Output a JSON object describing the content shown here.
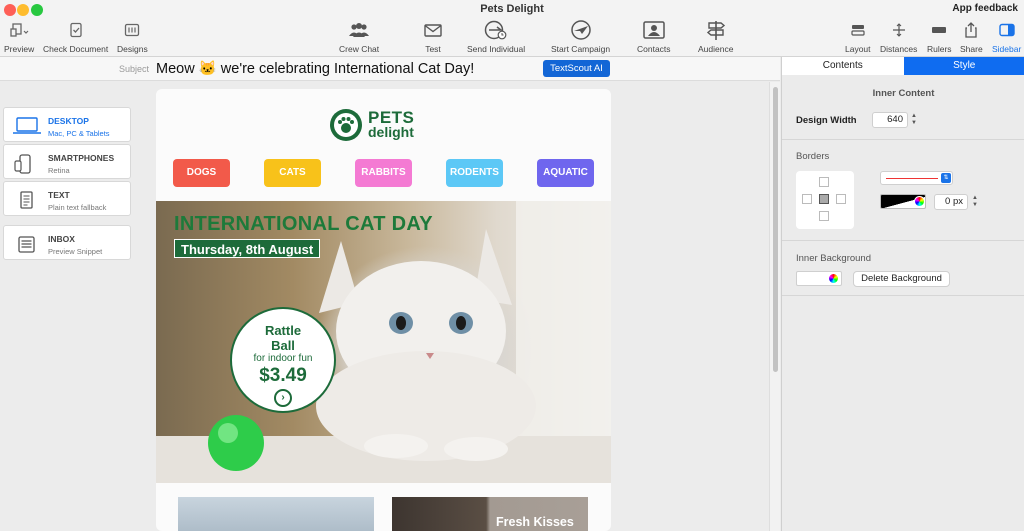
{
  "window": {
    "title": "Pets Delight",
    "feedback_label": "App feedback"
  },
  "toolbar": {
    "left": [
      {
        "label": "Preview",
        "icon": "preview-icon"
      },
      {
        "label": "Check Document",
        "icon": "check-document-icon"
      },
      {
        "label": "Designs",
        "icon": "designs-icon"
      }
    ],
    "center": [
      {
        "label": "Crew Chat",
        "icon": "crew-chat-icon"
      },
      {
        "label": "Test",
        "icon": "envelope-icon"
      },
      {
        "label": "Send Individual",
        "icon": "send-individual-icon"
      },
      {
        "label": "Start Campaign",
        "icon": "start-campaign-icon"
      },
      {
        "label": "Contacts",
        "icon": "contacts-icon"
      },
      {
        "label": "Audience",
        "icon": "signpost-icon"
      }
    ],
    "right": [
      {
        "label": "Layout",
        "icon": "layout-icon"
      },
      {
        "label": "Distances",
        "icon": "distances-icon"
      },
      {
        "label": "Rulers",
        "icon": "rulers-icon"
      },
      {
        "label": "Share",
        "icon": "share-icon"
      },
      {
        "label": "Sidebar",
        "icon": "sidebar-icon"
      }
    ]
  },
  "subject": {
    "label": "Subject",
    "text": "Meow 🐱 we're celebrating International Cat Day!",
    "ai_button": "TextScout AI"
  },
  "devices": [
    {
      "name": "DESKTOP",
      "sub": "Mac, PC & Tablets",
      "selected": true
    },
    {
      "name": "SMARTPHONES",
      "sub": "Retina",
      "selected": false
    },
    {
      "name": "TEXT",
      "sub": "Plain text fallback",
      "selected": false
    },
    {
      "name": "INBOX",
      "sub": "Preview Snippet",
      "selected": false
    }
  ],
  "email": {
    "logo_line1": "PETS",
    "logo_line2": "delight",
    "categories": [
      {
        "label": "DOGS",
        "color": "#f25a4a"
      },
      {
        "label": "CATS",
        "color": "#f8c21a"
      },
      {
        "label": "RABBITS",
        "color": "#f47ad3"
      },
      {
        "label": "RODENTS",
        "color": "#5cc8f6"
      },
      {
        "label": "AQUATIC",
        "color": "#6f66ee"
      }
    ],
    "hero_title": "INTERNATIONAL CAT DAY",
    "hero_date": "Thursday, 8th August",
    "promo": {
      "line1": "Rattle",
      "line2": "Ball",
      "line3": "for indoor fun",
      "price": "$3.49"
    },
    "thumb2_caption": "Fresh Kisses"
  },
  "inspector": {
    "tabs": [
      {
        "label": "Contents",
        "active": false
      },
      {
        "label": "Style",
        "active": true
      }
    ],
    "inner_content_title": "Inner Content",
    "design_width_label": "Design Width",
    "design_width_value": "640",
    "borders_title": "Borders",
    "border_width_value": "0 px",
    "inner_background_title": "Inner Background",
    "delete_background_label": "Delete Background"
  },
  "colors": {
    "accent": "#1366d6",
    "brand_green": "#1d6b3a"
  }
}
